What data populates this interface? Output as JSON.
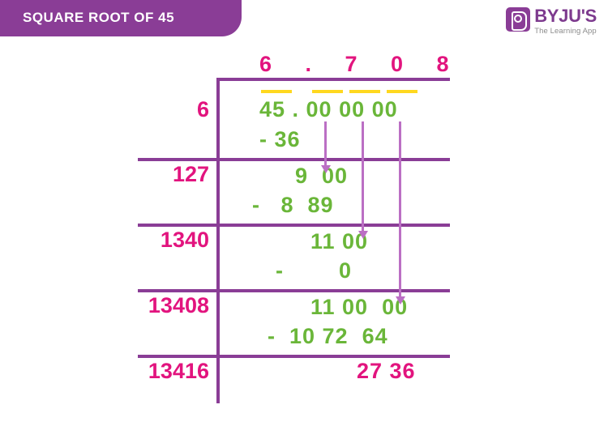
{
  "header": {
    "title": "SQUARE ROOT OF 45",
    "banner_color": "#8a3d96"
  },
  "logo": {
    "name": "BYJU'S",
    "tagline": "The Learning App",
    "mark_icon": "byjus-book-icon",
    "brand_color": "#7d3a8e"
  },
  "colors": {
    "pink": "#e2147e",
    "green": "#6ab639",
    "purple": "#8a3d96",
    "light_purple": "#bb6fc4",
    "yellow": "#ffd81f"
  },
  "worksheet": {
    "type": "long-division-square-root",
    "radicand": "45",
    "result": "6.708",
    "quotient_digits": [
      "6",
      ".",
      "7",
      "0",
      "8"
    ],
    "dividend_row": {
      "label": "6",
      "value": "45 . 00 00 00",
      "subtract": "- 36"
    },
    "steps": [
      {
        "divisor": "127",
        "bring_down": "9  00",
        "subtract": "-   8  89"
      },
      {
        "divisor": "1340",
        "bring_down": "11 00",
        "subtract": "-        0"
      },
      {
        "divisor": "13408",
        "bring_down": "11 00  00",
        "subtract": "-  10 72  64"
      }
    ],
    "final": {
      "divisor": "13416",
      "remainder": "27 36"
    }
  }
}
